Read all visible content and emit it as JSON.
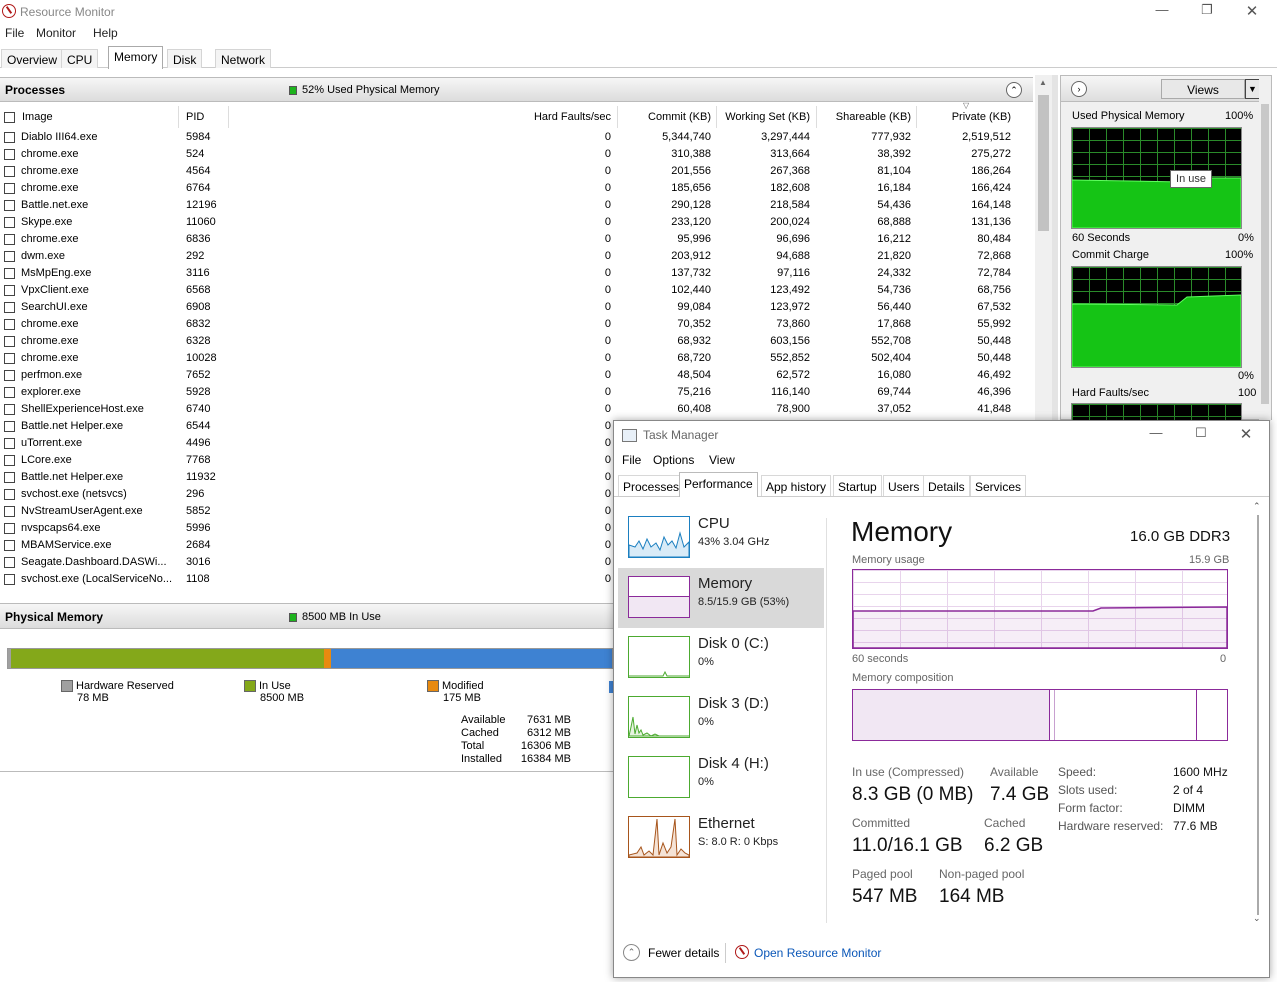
{
  "rm": {
    "title": "Resource Monitor",
    "menu": [
      "File",
      "Monitor",
      "Help"
    ],
    "tabs": [
      "Overview",
      "CPU",
      "Memory",
      "Disk",
      "Network"
    ],
    "processes": {
      "title": "Processes",
      "status": "52% Used Physical Memory",
      "columns": [
        "Image",
        "PID",
        "Hard Faults/sec",
        "Commit (KB)",
        "Working Set (KB)",
        "Shareable (KB)",
        "Private (KB)"
      ],
      "rows": [
        [
          "Diablo III64.exe",
          "5984",
          "0",
          "5,344,740",
          "3,297,444",
          "777,932",
          "2,519,512"
        ],
        [
          "chrome.exe",
          "524",
          "0",
          "310,388",
          "313,664",
          "38,392",
          "275,272"
        ],
        [
          "chrome.exe",
          "4564",
          "0",
          "201,556",
          "267,368",
          "81,104",
          "186,264"
        ],
        [
          "chrome.exe",
          "6764",
          "0",
          "185,656",
          "182,608",
          "16,184",
          "166,424"
        ],
        [
          "Battle.net.exe",
          "12196",
          "0",
          "290,128",
          "218,584",
          "54,436",
          "164,148"
        ],
        [
          "Skype.exe",
          "11060",
          "0",
          "233,120",
          "200,024",
          "68,888",
          "131,136"
        ],
        [
          "chrome.exe",
          "6836",
          "0",
          "95,996",
          "96,696",
          "16,212",
          "80,484"
        ],
        [
          "dwm.exe",
          "292",
          "0",
          "203,912",
          "94,688",
          "21,820",
          "72,868"
        ],
        [
          "MsMpEng.exe",
          "3116",
          "0",
          "137,732",
          "97,116",
          "24,332",
          "72,784"
        ],
        [
          "VpxClient.exe",
          "6568",
          "0",
          "102,440",
          "123,492",
          "54,736",
          "68,756"
        ],
        [
          "SearchUI.exe",
          "6908",
          "0",
          "99,084",
          "123,972",
          "56,440",
          "67,532"
        ],
        [
          "chrome.exe",
          "6832",
          "0",
          "70,352",
          "73,860",
          "17,868",
          "55,992"
        ],
        [
          "chrome.exe",
          "6328",
          "0",
          "68,932",
          "603,156",
          "552,708",
          "50,448"
        ],
        [
          "chrome.exe",
          "10028",
          "0",
          "68,720",
          "552,852",
          "502,404",
          "50,448"
        ],
        [
          "perfmon.exe",
          "7652",
          "0",
          "48,504",
          "62,572",
          "16,080",
          "46,492"
        ],
        [
          "explorer.exe",
          "5928",
          "0",
          "75,216",
          "116,140",
          "69,744",
          "46,396"
        ],
        [
          "ShellExperienceHost.exe",
          "6740",
          "0",
          "60,408",
          "78,900",
          "37,052",
          "41,848"
        ],
        [
          "Battle.net Helper.exe",
          "6544",
          "0",
          "",
          "",
          "",
          ""
        ],
        [
          "uTorrent.exe",
          "4496",
          "0",
          "",
          "",
          "",
          ""
        ],
        [
          "LCore.exe",
          "7768",
          "0",
          "",
          "",
          "",
          ""
        ],
        [
          "Battle.net Helper.exe",
          "11932",
          "0",
          "",
          "",
          "",
          ""
        ],
        [
          "svchost.exe (netsvcs)",
          "296",
          "0",
          "",
          "",
          "",
          ""
        ],
        [
          "NvStreamUserAgent.exe",
          "5852",
          "0",
          "",
          "",
          "",
          ""
        ],
        [
          "nvspcaps64.exe",
          "5996",
          "0",
          "",
          "",
          "",
          ""
        ],
        [
          "MBAMService.exe",
          "2684",
          "0",
          "",
          "",
          "",
          ""
        ],
        [
          "Seagate.Dashboard.DASWi...",
          "3016",
          "0",
          "",
          "",
          "",
          ""
        ],
        [
          "svchost.exe (LocalServiceNo...",
          "1108",
          "0",
          "",
          "",
          "",
          ""
        ]
      ]
    },
    "physical": {
      "title": "Physical Memory",
      "status": "8500 MB In Use",
      "legend": [
        {
          "label": "Hardware Reserved",
          "value": "78 MB",
          "color": "#a0a0a0"
        },
        {
          "label": "In Use",
          "value": "8500 MB",
          "color": "#84a81a"
        },
        {
          "label": "Modified",
          "value": "175 MB",
          "color": "#e88a10"
        }
      ],
      "stats": [
        [
          "Available",
          "7631 MB"
        ],
        [
          "Cached",
          "6312 MB"
        ],
        [
          "Total",
          "16306 MB"
        ],
        [
          "Installed",
          "16384 MB"
        ]
      ],
      "bar": {
        "hardware_reserved_mb": 78,
        "in_use_mb": 8500,
        "modified_mb": 175,
        "standby_color": "#3e82d2"
      }
    },
    "right": {
      "views": "Views",
      "graphs": [
        {
          "title": "Used Physical Memory",
          "max": "100%",
          "footer_left": "60 Seconds",
          "footer_right": "0%"
        },
        {
          "title": "Commit Charge",
          "max": "100%",
          "footer_right": "0%"
        },
        {
          "title": "Hard Faults/sec",
          "max": "100"
        }
      ],
      "tooltip": "In use"
    }
  },
  "tm": {
    "title": "Task Manager",
    "menu": [
      "File",
      "Options",
      "View"
    ],
    "tabs": [
      "Processes",
      "Performance",
      "App history",
      "Startup",
      "Users",
      "Details",
      "Services"
    ],
    "sidebar": [
      {
        "name": "CPU",
        "sub": "43%  3.04 GHz"
      },
      {
        "name": "Memory",
        "sub": "8.5/15.9 GB (53%)"
      },
      {
        "name": "Disk 0 (C:)",
        "sub": "0%"
      },
      {
        "name": "Disk 3 (D:)",
        "sub": "0%"
      },
      {
        "name": "Disk 4 (H:)",
        "sub": "0%"
      },
      {
        "name": "Ethernet",
        "sub": "S: 8.0  R: 0 Kbps"
      }
    ],
    "header": {
      "title": "Memory",
      "spec": "16.0 GB DDR3"
    },
    "usage": {
      "label": "Memory usage",
      "max": "15.9 GB",
      "left": "60 seconds",
      "right": "0"
    },
    "composition": {
      "label": "Memory composition"
    },
    "stats": [
      {
        "label": "In use (Compressed)",
        "value": "8.3 GB (0 MB)"
      },
      {
        "label": "Available",
        "value": "7.4 GB"
      },
      {
        "label": "Committed",
        "value": "11.0/16.1 GB"
      },
      {
        "label": "Cached",
        "value": "6.2 GB"
      },
      {
        "label": "Paged pool",
        "value": "547 MB"
      },
      {
        "label": "Non-paged pool",
        "value": "164 MB"
      }
    ],
    "props": [
      [
        "Speed:",
        "1600 MHz"
      ],
      [
        "Slots used:",
        "2 of 4"
      ],
      [
        "Form factor:",
        "DIMM"
      ],
      [
        "Hardware reserved:",
        "77.6 MB"
      ]
    ],
    "footer": {
      "fewer": "Fewer details",
      "open": "Open Resource Monitor"
    }
  }
}
